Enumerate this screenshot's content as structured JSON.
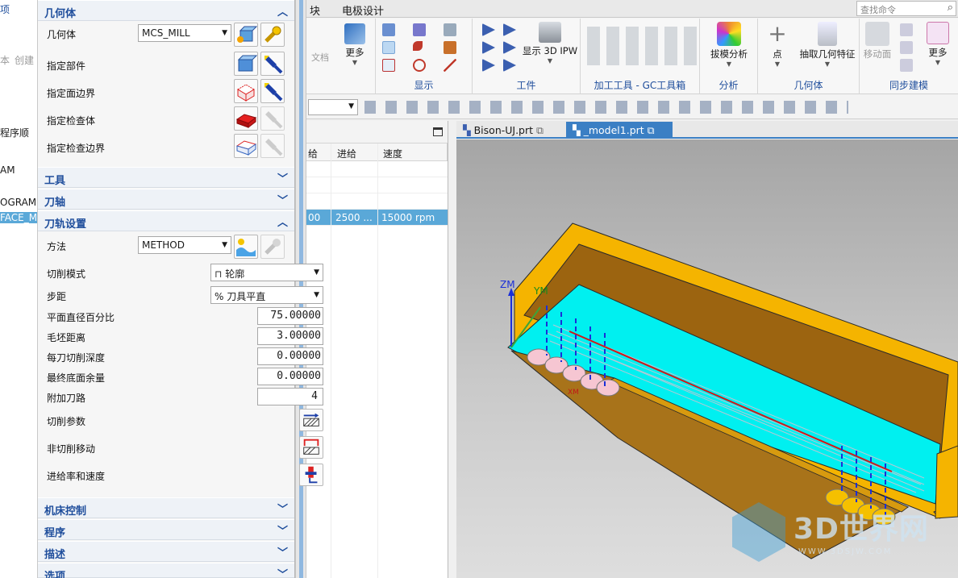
{
  "left_strip": {
    "rows": [
      "项",
      "本",
      "创建",
      "程序顺",
      "AM",
      "OGRAM",
      "FACE_M"
    ]
  },
  "ribbon": {
    "tabs": [
      "块",
      "电极设计"
    ],
    "search_placeholder": "查找命令",
    "groups": {
      "more_left_label": "更多",
      "doc_label": "文档",
      "display_label": "显示",
      "workpiece_label": "工件",
      "show_3d_ipw_label": "显示 3D IPW",
      "gc_label": "加工工具 - GC工具箱",
      "draft_label": "拔模分析",
      "analysis_label": "分析",
      "point_label": "点",
      "extract_label": "抽取几何特征",
      "geometry_label": "几何体",
      "move_face_label": "移动面",
      "sync_label": "同步建模",
      "more_right_label": "更多"
    }
  },
  "navigator": {
    "columns": [
      "进给",
      "速度"
    ],
    "partial_col": "给",
    "selected_row": {
      "a": "00",
      "feed": "2500 ...",
      "speed": "15000 rpm"
    }
  },
  "graphics": {
    "tabs": [
      {
        "label": "Bison-UJ.prt",
        "active": false
      },
      {
        "label": "_model1.prt",
        "active": true
      }
    ],
    "axis_labels": {
      "zm": "ZM",
      "ym": "YM",
      "xm": "XM"
    },
    "watermark_brand": "3D世界网",
    "watermark_url": "WWW.3DSJW.COM"
  },
  "dialog": {
    "sections": {
      "geometry": "几何体",
      "tool": "工具",
      "tool_axis": "刀轴",
      "path_settings": "刀轨设置",
      "machine_control": "机床控制",
      "program": "程序",
      "description": "描述",
      "options": "选项"
    },
    "geometry": {
      "geometry_label": "几何体",
      "geometry_value": "MCS_MILL",
      "specify_part": "指定部件",
      "specify_face_boundary": "指定面边界",
      "specify_check_body": "指定检查体",
      "specify_check_boundary": "指定检查边界"
    },
    "path": {
      "method_label": "方法",
      "method_value": "METHOD",
      "cut_pattern_label": "切削模式",
      "cut_pattern_value": "轮廓",
      "stepover_label": "步距",
      "stepover_value": "% 刀具平直",
      "flat_pct_label": "平面直径百分比",
      "flat_pct_value": "75.00000",
      "blank_dist_label": "毛坯距离",
      "blank_dist_value": "3.00000",
      "depth_per_cut_label": "每刀切削深度",
      "depth_per_cut_value": "0.00000",
      "final_floor_label": "最终底面余量",
      "final_floor_value": "0.00000",
      "extra_passes_label": "附加刀路",
      "extra_passes_value": "4",
      "cut_params_label": "切削参数",
      "non_cut_label": "非切削移动",
      "feeds_label": "进给率和速度"
    }
  },
  "colors": {
    "accent_blue": "#1f4e9c",
    "part_orange": "#f5b400",
    "pocket_cyan": "#00f0f0",
    "wall_brown": "#9c6410",
    "selection_blue": "#5aa8d8"
  }
}
